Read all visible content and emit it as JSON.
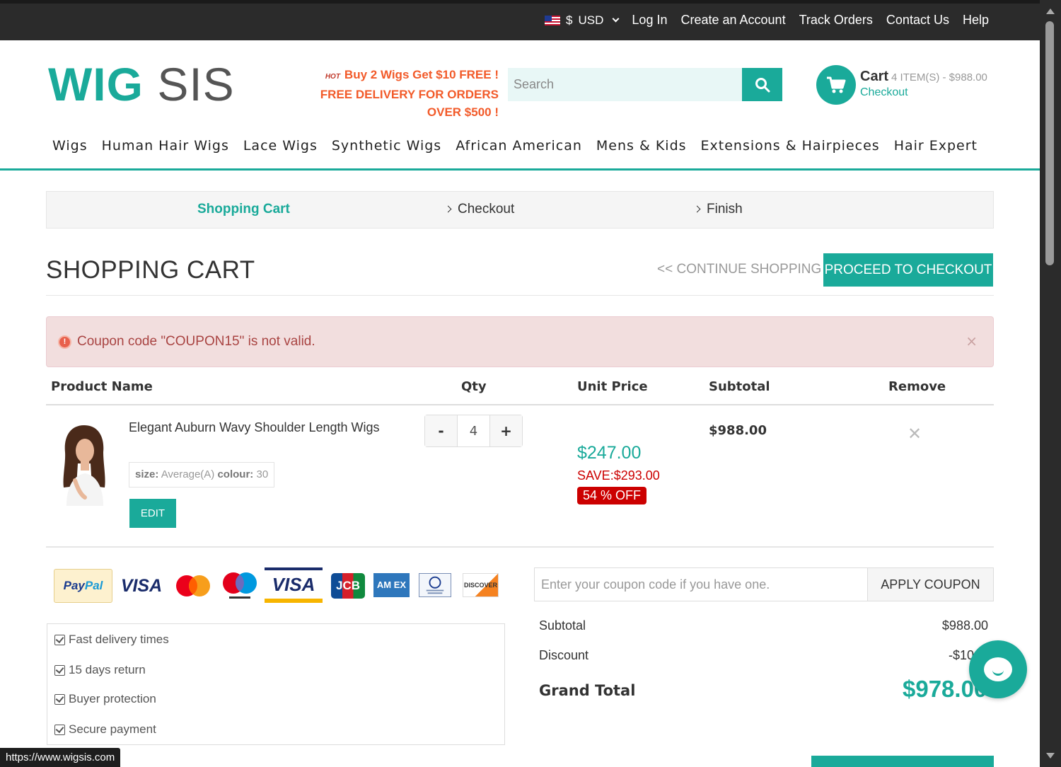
{
  "topbar": {
    "currency_symbol": "$",
    "currency": "USD",
    "links": [
      "Log In",
      "Create an Account",
      "Track Orders",
      "Contact Us",
      "Help"
    ]
  },
  "header": {
    "logo_part1": "WIG",
    "logo_part2": "SIS",
    "promo_hot": "HOT",
    "promo_line1": "Buy 2 Wigs Get $10 FREE !",
    "promo_line2": "FREE DELIVERY FOR ORDERS",
    "promo_line3": "OVER $500 !",
    "search_placeholder": "Search",
    "cart_label": "Cart",
    "cart_summary": "4 ITEM(S) - $988.00",
    "checkout_link": "Checkout"
  },
  "nav": [
    "Wigs",
    "Human Hair Wigs",
    "Lace Wigs",
    "Synthetic Wigs",
    "African American",
    "Mens & Kids",
    "Extensions & Hairpieces",
    "Hair Expert"
  ],
  "steps": [
    "Shopping Cart",
    "Checkout",
    "Finish"
  ],
  "page": {
    "title": "SHOPPING CART",
    "continue_shopping": "<< CONTINUE SHOPPING",
    "proceed_checkout": "PROCEED TO CHECKOUT"
  },
  "alert": {
    "message": "Coupon code \"COUPON15\" is not valid.",
    "close": "×"
  },
  "table": {
    "headers": [
      "Product Name",
      "Qty",
      "Unit Price",
      "Subtotal",
      "Remove"
    ]
  },
  "item": {
    "name": "Elegant Auburn Wavy Shoulder Length Wigs",
    "size_label": "size:",
    "size_value": "Average(A)",
    "colour_label": "colour:",
    "colour_value": "30",
    "edit": "EDIT",
    "qty_minus": "-",
    "qty": "4",
    "qty_plus": "+",
    "unit_price": "$247.00",
    "save": "SAVE:$293.00",
    "off": "54 % OFF",
    "subtotal": "$988.00",
    "remove": "✕"
  },
  "payments": {
    "paypal_a": "Pay",
    "paypal_b": "Pal",
    "visa": "VISA",
    "visa_electron": "VISA",
    "jcb": "JCB",
    "amex": "AM EX",
    "discover": "DISCOVER"
  },
  "guarantees": [
    "Fast delivery times",
    "15 days return",
    "Buyer protection",
    "Secure payment"
  ],
  "coupon": {
    "placeholder": "Enter your coupon code if you have one.",
    "apply": "APPLY COUPON"
  },
  "totals": {
    "subtotal_label": "Subtotal",
    "subtotal": "$988.00",
    "discount_label": "Discount",
    "discount": "-$10",
    "grand_label": "Grand Total",
    "grand": "$978.00"
  },
  "status_url": "https://www.wigsis.com",
  "colors": {
    "accent": "#1aaa9a",
    "promo": "#f25a29",
    "sale": "#cc0000",
    "topbar": "#2b2b2b"
  }
}
